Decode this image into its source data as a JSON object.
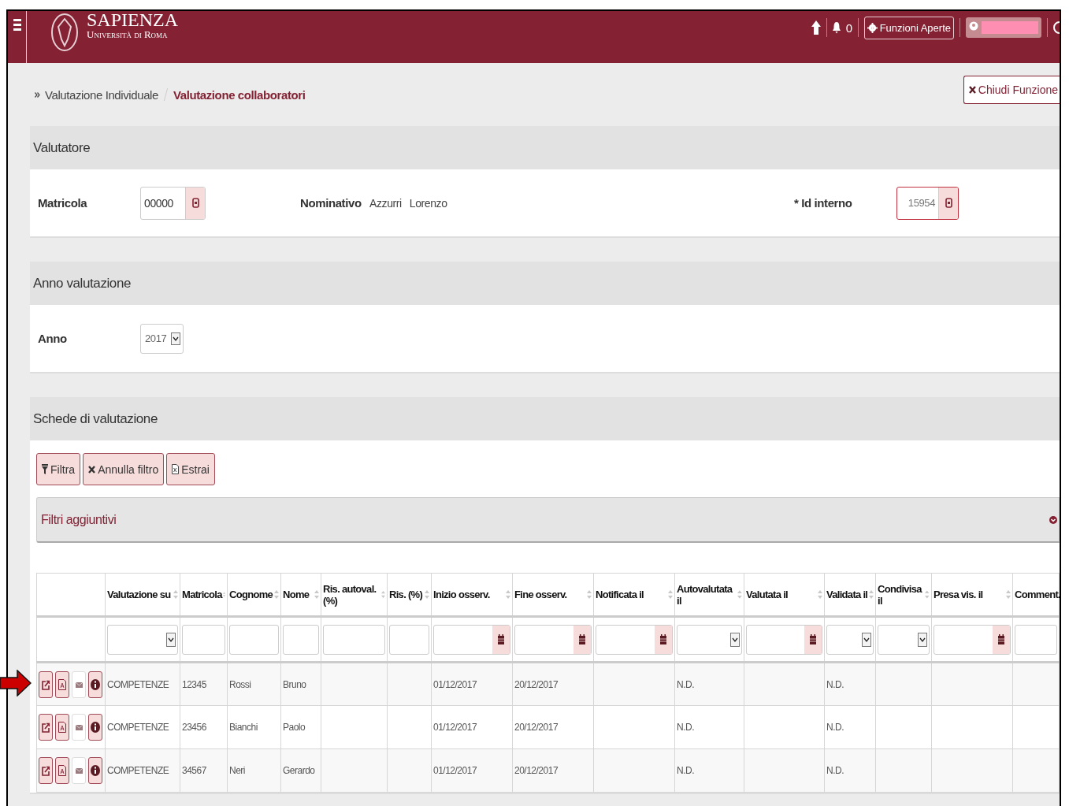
{
  "header": {
    "logo_title": "SAPIENZA",
    "logo_subtitle": "Università di Roma",
    "notifications": "0",
    "open_functions": "Funzioni Aperte"
  },
  "breadcrumb": [
    {
      "label": "Valutazione Individuale",
      "selected": false
    },
    {
      "label": "Valutazione collaboratori",
      "selected": true
    }
  ],
  "close_button": "Chiudi Funzione",
  "valutatore": {
    "title": "Valutatore",
    "matricola_label": "Matricola",
    "matricola_value": "00000",
    "nominativo_label": "Nominativo",
    "nominativo_values": [
      "Azzurri",
      "Lorenzo"
    ],
    "id_label": "* Id interno",
    "id_value": "15954",
    "id_required": true
  },
  "anno_section": {
    "title": "Anno valutazione",
    "anno_label": "Anno",
    "anno_value": "2017"
  },
  "schede": {
    "title": "Schede di valutazione",
    "buttons": [
      {
        "kind": "filter",
        "label": "Filtra"
      },
      {
        "kind": "clear",
        "label": "Annulla filtro"
      },
      {
        "kind": "export",
        "label": "Estrai"
      }
    ],
    "extra_filters": "Filtri aggiuntivi",
    "columns": [
      {
        "kind": "actions"
      },
      {
        "label": "Valutazione su",
        "kind": "select"
      },
      {
        "label": "Matricola",
        "kind": "text"
      },
      {
        "label": "Cognome",
        "kind": "text"
      },
      {
        "label": "Nome",
        "kind": "text"
      },
      {
        "label": "Ris. autoval. (%)",
        "kind": "text"
      },
      {
        "label": "Ris. (%)",
        "kind": "text"
      },
      {
        "label": "Inizio osserv.",
        "kind": "date"
      },
      {
        "label": "Fine osserv.",
        "kind": "date"
      },
      {
        "label": "Notificata il",
        "kind": "date"
      },
      {
        "label": "Autovalutata il",
        "kind": "select"
      },
      {
        "label": "Valutata il",
        "kind": "date"
      },
      {
        "label": "Validata il",
        "kind": "select"
      },
      {
        "label": "Condivisa il",
        "kind": "select"
      },
      {
        "label": "Presa vis. il",
        "kind": "date"
      },
      {
        "label": "Comment.",
        "kind": "text"
      }
    ],
    "rows": [
      {
        "actions": [
          {
            "kind": "edit",
            "disabled": false
          },
          {
            "kind": "pdf",
            "disabled": false
          },
          {
            "kind": "mail",
            "disabled": true
          },
          {
            "kind": "info",
            "disabled": false
          }
        ],
        "valutazione_su": "COMPETENZE",
        "matricola": "12345",
        "cognome": "Rossi",
        "nome": "Bruno",
        "inizio_osserv": "01/12/2017",
        "fine_osserv": "20/12/2017",
        "autovalutata_il": "N.D.",
        "validata_il": "N.D."
      },
      {
        "actions": [
          {
            "kind": "edit",
            "disabled": false
          },
          {
            "kind": "pdf",
            "disabled": false
          },
          {
            "kind": "mail",
            "disabled": true
          },
          {
            "kind": "info",
            "disabled": false
          }
        ],
        "valutazione_su": "COMPETENZE",
        "matricola": "23456",
        "cognome": "Bianchi",
        "nome": "Paolo",
        "inizio_osserv": "01/12/2017",
        "fine_osserv": "20/12/2017",
        "autovalutata_il": "N.D.",
        "validata_il": "N.D."
      },
      {
        "actions": [
          {
            "kind": "edit",
            "disabled": false
          },
          {
            "kind": "pdf",
            "disabled": false
          },
          {
            "kind": "mail",
            "disabled": true
          },
          {
            "kind": "info",
            "disabled": false
          }
        ],
        "valutazione_su": "COMPETENZE",
        "matricola": "34567",
        "cognome": "Neri",
        "nome": "Gerardo",
        "inizio_osserv": "01/12/2017",
        "fine_osserv": "20/12/2017",
        "autovalutata_il": "N.D.",
        "validata_il": "N.D."
      }
    ]
  }
}
